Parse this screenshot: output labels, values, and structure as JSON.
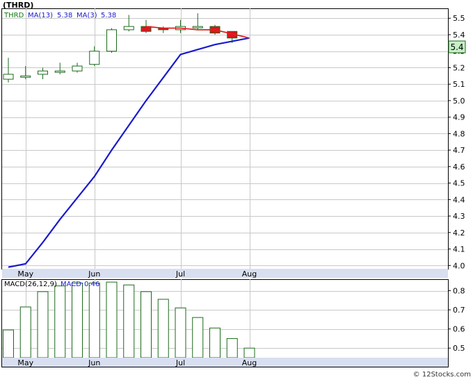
{
  "header": {
    "title": "(THRD)"
  },
  "watermark": "© 12Stocks.com",
  "colors": {
    "ma_long": "#1a1acc",
    "ma_short": "#e02020",
    "candle_up_fill": "#ffffff",
    "candle_down_fill": "#e0141e",
    "candle_outline": "#1a6a1a",
    "macd_bar": "#1a6a1a",
    "grid": "#c8c8c8",
    "frame": "#000000",
    "date_bar": "#d8dff0",
    "legend_text": "#0a7a0a",
    "legend_text_blue": "#1a1acc",
    "last_price_bg": "#c8f0c8"
  },
  "chart_data": [
    {
      "type": "candlestick",
      "name": "price-panel",
      "legend": [
        {
          "label": "THRD",
          "value": ""
        },
        {
          "label": "MA(13)",
          "value": "5.38"
        },
        {
          "label": "MA(3)",
          "value": "5.38"
        }
      ],
      "x_tick_labels": [
        "May",
        "Jun",
        "Jul",
        "Aug"
      ],
      "x_tick_index": [
        1,
        5,
        10,
        14
      ],
      "y_ticks": [
        4.0,
        4.1,
        4.2,
        4.3,
        4.4,
        4.5,
        4.6,
        4.7,
        4.8,
        4.9,
        5.0,
        5.1,
        5.2,
        5.3,
        5.4,
        5.5
      ],
      "y_tick_labels": [
        "4.0",
        "4.1",
        "4.2",
        "4.3",
        "4.4",
        "4.5",
        "4.6",
        "4.7",
        "4.8",
        "4.9",
        "5.0",
        "5.1",
        "5.2",
        "5.3",
        "5.4",
        "5.5"
      ],
      "ylim": [
        3.98,
        5.56
      ],
      "last_price_label": "5.4",
      "grid": true,
      "candles": [
        {
          "o": 5.13,
          "h": 5.26,
          "l": 5.11,
          "c": 5.16,
          "dir": "up"
        },
        {
          "o": 5.15,
          "h": 5.21,
          "l": 5.13,
          "c": 5.15,
          "dir": "up"
        },
        {
          "o": 5.16,
          "h": 5.2,
          "l": 5.13,
          "c": 5.18,
          "dir": "up"
        },
        {
          "o": 5.18,
          "h": 5.23,
          "l": 5.16,
          "c": 5.18,
          "dir": "up"
        },
        {
          "o": 5.18,
          "h": 5.23,
          "l": 5.17,
          "c": 5.21,
          "dir": "up"
        },
        {
          "o": 5.22,
          "h": 5.33,
          "l": 5.21,
          "c": 5.3,
          "dir": "up"
        },
        {
          "o": 5.3,
          "h": 5.44,
          "l": 5.29,
          "c": 5.43,
          "dir": "up"
        },
        {
          "o": 5.43,
          "h": 5.52,
          "l": 5.42,
          "c": 5.45,
          "dir": "up"
        },
        {
          "o": 5.45,
          "h": 5.49,
          "l": 5.41,
          "c": 5.42,
          "dir": "down"
        },
        {
          "o": 5.44,
          "h": 5.45,
          "l": 5.41,
          "c": 5.43,
          "dir": "down"
        },
        {
          "o": 5.43,
          "h": 5.49,
          "l": 5.41,
          "c": 5.45,
          "dir": "up"
        },
        {
          "o": 5.45,
          "h": 5.53,
          "l": 5.43,
          "c": 5.45,
          "dir": "up"
        },
        {
          "o": 5.45,
          "h": 5.46,
          "l": 5.4,
          "c": 5.41,
          "dir": "down"
        },
        {
          "o": 5.42,
          "h": 5.42,
          "l": 5.35,
          "c": 5.38,
          "dir": "down"
        }
      ],
      "ma_long": {
        "name": "MA(13)",
        "values": [
          3.99,
          4.01,
          4.14,
          4.28,
          4.41,
          4.54,
          4.7,
          4.85,
          5.0,
          5.14,
          5.28,
          5.31,
          5.34,
          5.36,
          5.38
        ]
      },
      "ma_long_x_index": [
        0,
        1,
        2,
        3,
        4,
        5,
        6,
        7,
        8,
        9,
        10,
        11,
        12,
        13,
        14
      ],
      "ma_short": {
        "name": "MA(3)",
        "values": [
          5.45,
          5.44,
          5.44,
          5.43,
          5.43,
          5.38
        ]
      },
      "ma_short_x_index": [
        8,
        9,
        10,
        11,
        12,
        14
      ]
    },
    {
      "type": "bar",
      "name": "macd-panel",
      "legend": [
        {
          "label": "MACD(26,12,9)",
          "value": ""
        },
        {
          "label": "MACD:",
          "value": "0.46"
        }
      ],
      "x_tick_labels": [
        "May",
        "Jun",
        "Jul",
        "Aug"
      ],
      "x_tick_index": [
        1,
        5,
        10,
        14
      ],
      "y_ticks": [
        0.5,
        0.6,
        0.7,
        0.8
      ],
      "y_tick_labels": [
        "0.5",
        "0.6",
        "0.7",
        "0.8"
      ],
      "ylim": [
        0.45,
        0.86
      ],
      "values": [
        0.595,
        0.715,
        0.795,
        0.825,
        0.84,
        0.84,
        0.845,
        0.83,
        0.795,
        0.755,
        0.71,
        0.66,
        0.605,
        0.55,
        0.5
      ]
    }
  ]
}
